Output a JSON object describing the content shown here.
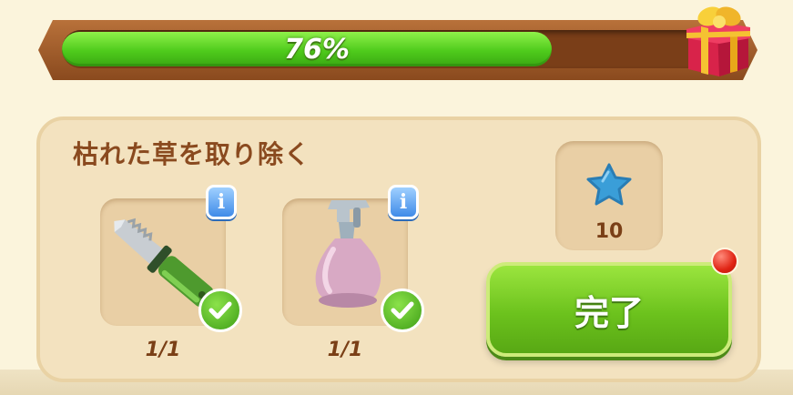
{
  "progress": {
    "percent": 76,
    "label": "76%",
    "icon": "gift-box-icon"
  },
  "quest": {
    "title": "枯れた草を取り除く",
    "items": [
      {
        "icon": "knife-icon",
        "count": "1/1",
        "info_label": "i",
        "completed": true
      },
      {
        "icon": "spray-bottle-icon",
        "count": "1/1",
        "info_label": "i",
        "completed": true
      }
    ],
    "reward": {
      "icon": "blue-star-icon",
      "count": "10"
    },
    "complete_button": "完了"
  },
  "colors": {
    "progress_fill": "#4fcb1c",
    "panel": "#f3e2bf",
    "title_text": "#8a4a1f",
    "button": "#6cc21d",
    "notification": "#e02414",
    "info": "#3f8be8"
  }
}
